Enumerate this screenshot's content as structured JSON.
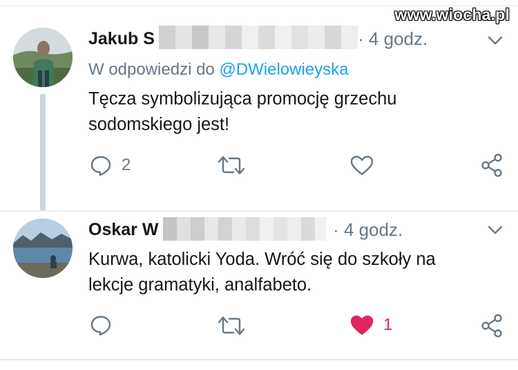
{
  "watermark": "www.wiocha.pl",
  "tweets": [
    {
      "author": "Jakub S",
      "time": "· 4 godz.",
      "reply_prefix": "W odpowiedzi do ",
      "reply_handle": "@DWielowieyska",
      "text_line1": "Tęcza symbolizująca promocję grzechu",
      "text_line2": "sodomskiego jest!",
      "reply_count": "2",
      "retweet_count": "",
      "like_count": "",
      "liked": false
    },
    {
      "author": "Oskar W",
      "time": "· 4 godz.",
      "text_line1": "Kurwa, katolicki Yoda. Wróć się do szkoły na",
      "text_line2": "lekcje gramatyki, analfabeto.",
      "reply_count": "",
      "retweet_count": "",
      "like_count": "1",
      "liked": true
    }
  ],
  "colors": {
    "text_primary": "#14171a",
    "text_secondary": "#657786",
    "link": "#1da1f2",
    "like_active": "#e0245e",
    "icon": "#657786",
    "thread_line": "#ccd6dd"
  },
  "icons": [
    "reply-icon",
    "retweet-icon",
    "like-icon",
    "share-icon",
    "chevron-down-icon"
  ]
}
